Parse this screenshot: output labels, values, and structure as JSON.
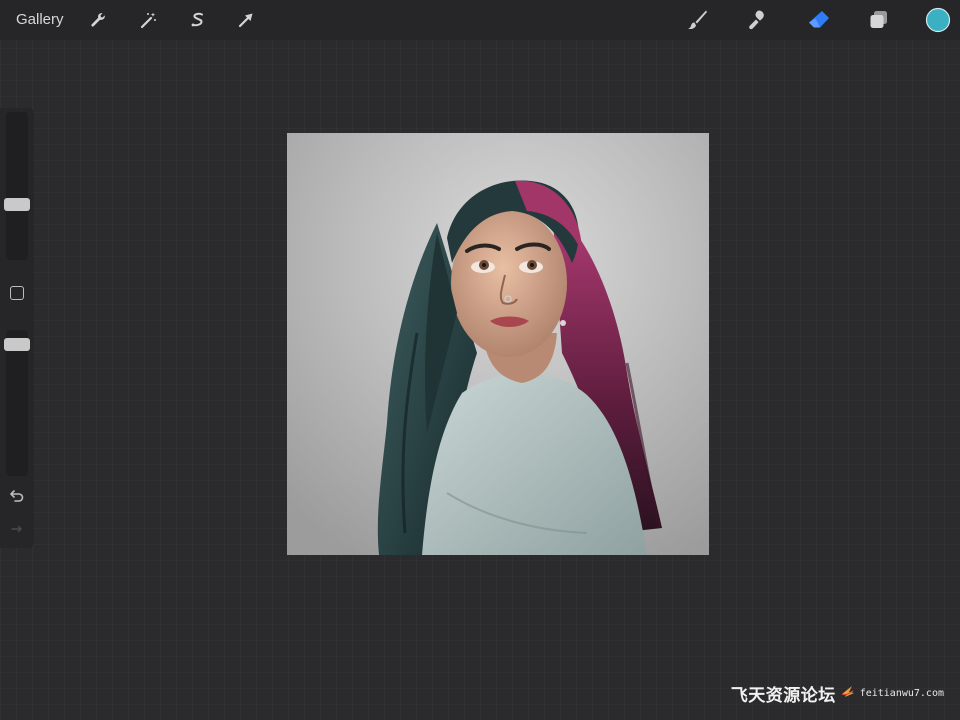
{
  "toolbar": {
    "gallery_label": "Gallery",
    "left_tools": [
      {
        "icon": "wrench-icon",
        "label": "Actions"
      },
      {
        "icon": "magic-wand-icon",
        "label": "Adjustments"
      },
      {
        "icon": "selection-icon",
        "label": "Selection"
      },
      {
        "icon": "transform-arrow-icon",
        "label": "Transform"
      }
    ],
    "right_tools": [
      {
        "icon": "brush-icon",
        "label": "Paint"
      },
      {
        "icon": "smudge-icon",
        "label": "Smudge"
      },
      {
        "icon": "eraser-icon",
        "label": "Erase",
        "active": true
      },
      {
        "icon": "layers-icon",
        "label": "Layers"
      }
    ],
    "color_swatch": "#3ab0c2",
    "active_tool_color": "#2f7df6"
  },
  "sidebar": {
    "brush_size_level": 0.64,
    "opacity_level": 0.06
  },
  "canvas": {
    "artwork_subject": "portrait painting"
  },
  "watermark": {
    "chinese_text": "飞天资源论坛",
    "url": "feitianwu7.com"
  }
}
